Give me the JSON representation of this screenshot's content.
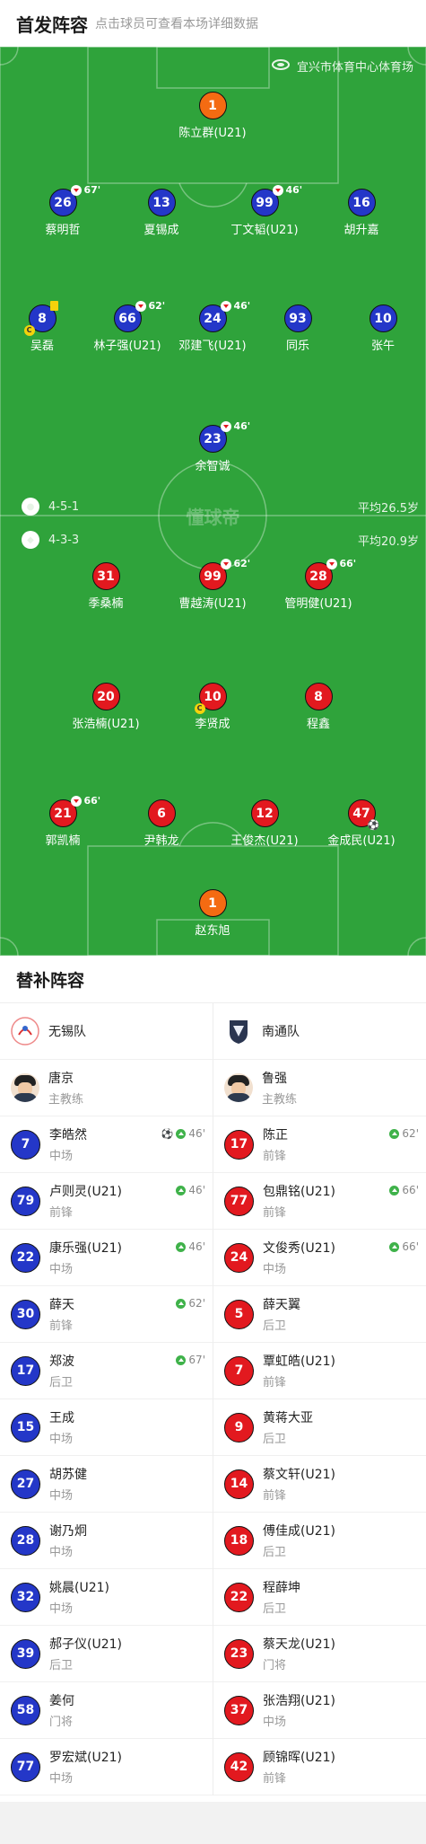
{
  "header": {
    "title": "首发阵容",
    "subtitle": "点击球员可查看本场详细数据"
  },
  "stadium": "宜兴市体育中心体育场",
  "watermark": "懂球帝",
  "home": {
    "formation": "4-5-1",
    "avg_age": "平均26.5岁"
  },
  "away": {
    "formation": "4-3-3",
    "avg_age": "平均20.9岁"
  },
  "home_players": [
    {
      "num": "1",
      "name": "陈立群(U21)",
      "sub": ""
    },
    {
      "num": "26",
      "name": "蔡明哲",
      "sub": "67'"
    },
    {
      "num": "13",
      "name": "夏锡成",
      "sub": ""
    },
    {
      "num": "99",
      "name": "丁文韬(U21)",
      "sub": "46'"
    },
    {
      "num": "16",
      "name": "胡升嘉",
      "sub": ""
    },
    {
      "num": "8",
      "name": "吴磊",
      "sub": ""
    },
    {
      "num": "66",
      "name": "林子强(U21)",
      "sub": "62'"
    },
    {
      "num": "24",
      "name": "邓建飞(U21)",
      "sub": "46'"
    },
    {
      "num": "93",
      "name": "同乐",
      "sub": ""
    },
    {
      "num": "10",
      "name": "张午",
      "sub": ""
    },
    {
      "num": "23",
      "name": "余智诚",
      "sub": "46'"
    }
  ],
  "away_players": [
    {
      "num": "31",
      "name": "季桑楠",
      "sub": ""
    },
    {
      "num": "99",
      "name": "曹越涛(U21)",
      "sub": "62'"
    },
    {
      "num": "28",
      "name": "管明健(U21)",
      "sub": "66'"
    },
    {
      "num": "20",
      "name": "张浩楠(U21)",
      "sub": ""
    },
    {
      "num": "10",
      "name": "李贤成",
      "sub": ""
    },
    {
      "num": "8",
      "name": "程鑫",
      "sub": ""
    },
    {
      "num": "21",
      "name": "郭凯楠",
      "sub": "66'"
    },
    {
      "num": "6",
      "name": "尹韩龙",
      "sub": ""
    },
    {
      "num": "12",
      "name": "王俊杰(U21)",
      "sub": ""
    },
    {
      "num": "47",
      "name": "金成民(U21)",
      "sub": ""
    },
    {
      "num": "1",
      "name": "赵东旭",
      "sub": ""
    }
  ],
  "subs_title": "替补阵容",
  "home_team": {
    "club": "无锡队",
    "coach": {
      "name": "唐京",
      "role": "主教练"
    },
    "subs": [
      {
        "num": "7",
        "name": "李皓然",
        "pos": "中场",
        "tag": "46'",
        "goal": true
      },
      {
        "num": "79",
        "name": "卢则灵(U21)",
        "pos": "前锋",
        "tag": "46'"
      },
      {
        "num": "22",
        "name": "康乐强(U21)",
        "pos": "中场",
        "tag": "46'"
      },
      {
        "num": "30",
        "name": "薛天",
        "pos": "前锋",
        "tag": "62'"
      },
      {
        "num": "17",
        "name": "郑波",
        "pos": "后卫",
        "tag": "67'"
      },
      {
        "num": "15",
        "name": "王成",
        "pos": "中场",
        "tag": ""
      },
      {
        "num": "27",
        "name": "胡苏健",
        "pos": "中场",
        "tag": ""
      },
      {
        "num": "28",
        "name": "谢乃炯",
        "pos": "中场",
        "tag": ""
      },
      {
        "num": "32",
        "name": "姚晨(U21)",
        "pos": "中场",
        "tag": ""
      },
      {
        "num": "39",
        "name": "郝子仪(U21)",
        "pos": "后卫",
        "tag": ""
      },
      {
        "num": "58",
        "name": "姜何",
        "pos": "门将",
        "tag": ""
      },
      {
        "num": "77",
        "name": "罗宏斌(U21)",
        "pos": "中场",
        "tag": ""
      }
    ]
  },
  "away_team": {
    "club": "南通队",
    "coach": {
      "name": "鲁强",
      "role": "主教练"
    },
    "subs": [
      {
        "num": "17",
        "name": "陈正",
        "pos": "前锋",
        "tag": "62'"
      },
      {
        "num": "77",
        "name": "包鼎铭(U21)",
        "pos": "前锋",
        "tag": "66'"
      },
      {
        "num": "24",
        "name": "文俊秀(U21)",
        "pos": "中场",
        "tag": "66'"
      },
      {
        "num": "5",
        "name": "薛天翼",
        "pos": "后卫",
        "tag": ""
      },
      {
        "num": "7",
        "name": "覃虹皓(U21)",
        "pos": "前锋",
        "tag": ""
      },
      {
        "num": "9",
        "name": "黄蒋大亚",
        "pos": "后卫",
        "tag": ""
      },
      {
        "num": "14",
        "name": "蔡文轩(U21)",
        "pos": "前锋",
        "tag": ""
      },
      {
        "num": "18",
        "name": "傅佳成(U21)",
        "pos": "后卫",
        "tag": ""
      },
      {
        "num": "22",
        "name": "程薛坤",
        "pos": "后卫",
        "tag": ""
      },
      {
        "num": "23",
        "name": "蔡天龙(U21)",
        "pos": "门将",
        "tag": ""
      },
      {
        "num": "37",
        "name": "张浩翔(U21)",
        "pos": "中场",
        "tag": ""
      },
      {
        "num": "42",
        "name": "顾锦晖(U21)",
        "pos": "前锋",
        "tag": ""
      }
    ]
  }
}
